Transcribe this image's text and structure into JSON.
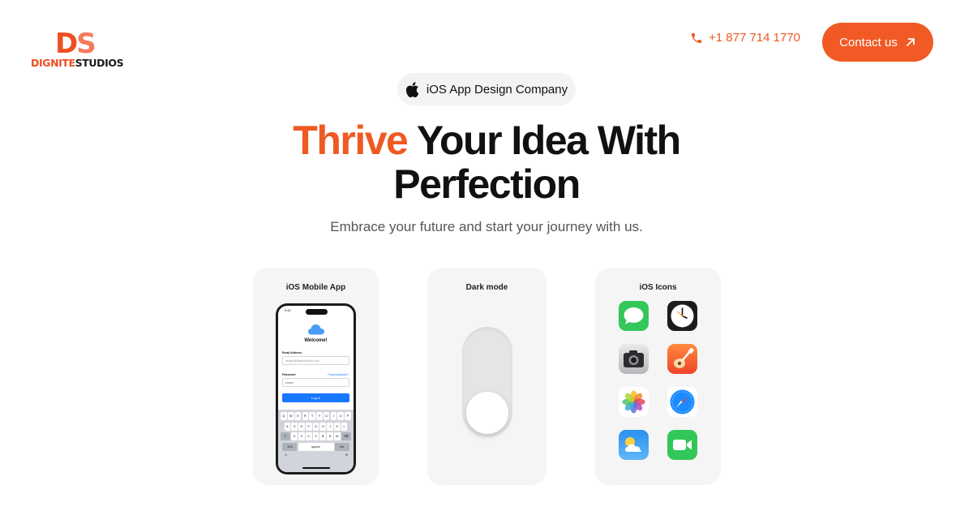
{
  "brand": {
    "mark_d": "D",
    "mark_s": "S",
    "name_part1": "DIGNITE",
    "name_part2": "STUDIOS"
  },
  "header": {
    "phone": "+1 877 714 1770",
    "contact_label": "Contact us"
  },
  "hero": {
    "badge": "iOS App Design Company",
    "title_accent": "Thrive",
    "title_line1_rest": " Your Idea With",
    "title_line2": "Perfection",
    "subtitle": "Embrace your future and start your journey with us."
  },
  "cards": {
    "mobile_app": {
      "title": "iOS Mobile App",
      "phone": {
        "time": "9:41",
        "welcome": "Welcome!",
        "email_label": "Email Address",
        "email_value": "design@digniteStudio.com",
        "password_label": "Password",
        "forgot": "Forgot password?",
        "password_value": "••••••••",
        "login": "Log in",
        "keys_row1": [
          "Q",
          "W",
          "E",
          "R",
          "T",
          "Y",
          "U",
          "I",
          "O",
          "P"
        ],
        "keys_row2": [
          "A",
          "S",
          "D",
          "F",
          "G",
          "H",
          "J",
          "K",
          "L"
        ],
        "keys_row3": [
          "Z",
          "X",
          "C",
          "V",
          "B",
          "N",
          "M"
        ],
        "key_123": "123",
        "key_space": "space",
        "key_go": "Go"
      }
    },
    "dark_mode": {
      "title": "Dark mode"
    },
    "icons": {
      "title": "iOS Icons",
      "items": [
        "messages-icon",
        "clock-icon",
        "camera-icon",
        "garageband-icon",
        "photos-icon",
        "safari-icon",
        "weather-icon",
        "facetime-icon"
      ]
    }
  },
  "colors": {
    "accent": "#F15A24",
    "card_bg": "#F5F5F5",
    "ios_blue": "#1677FF"
  }
}
